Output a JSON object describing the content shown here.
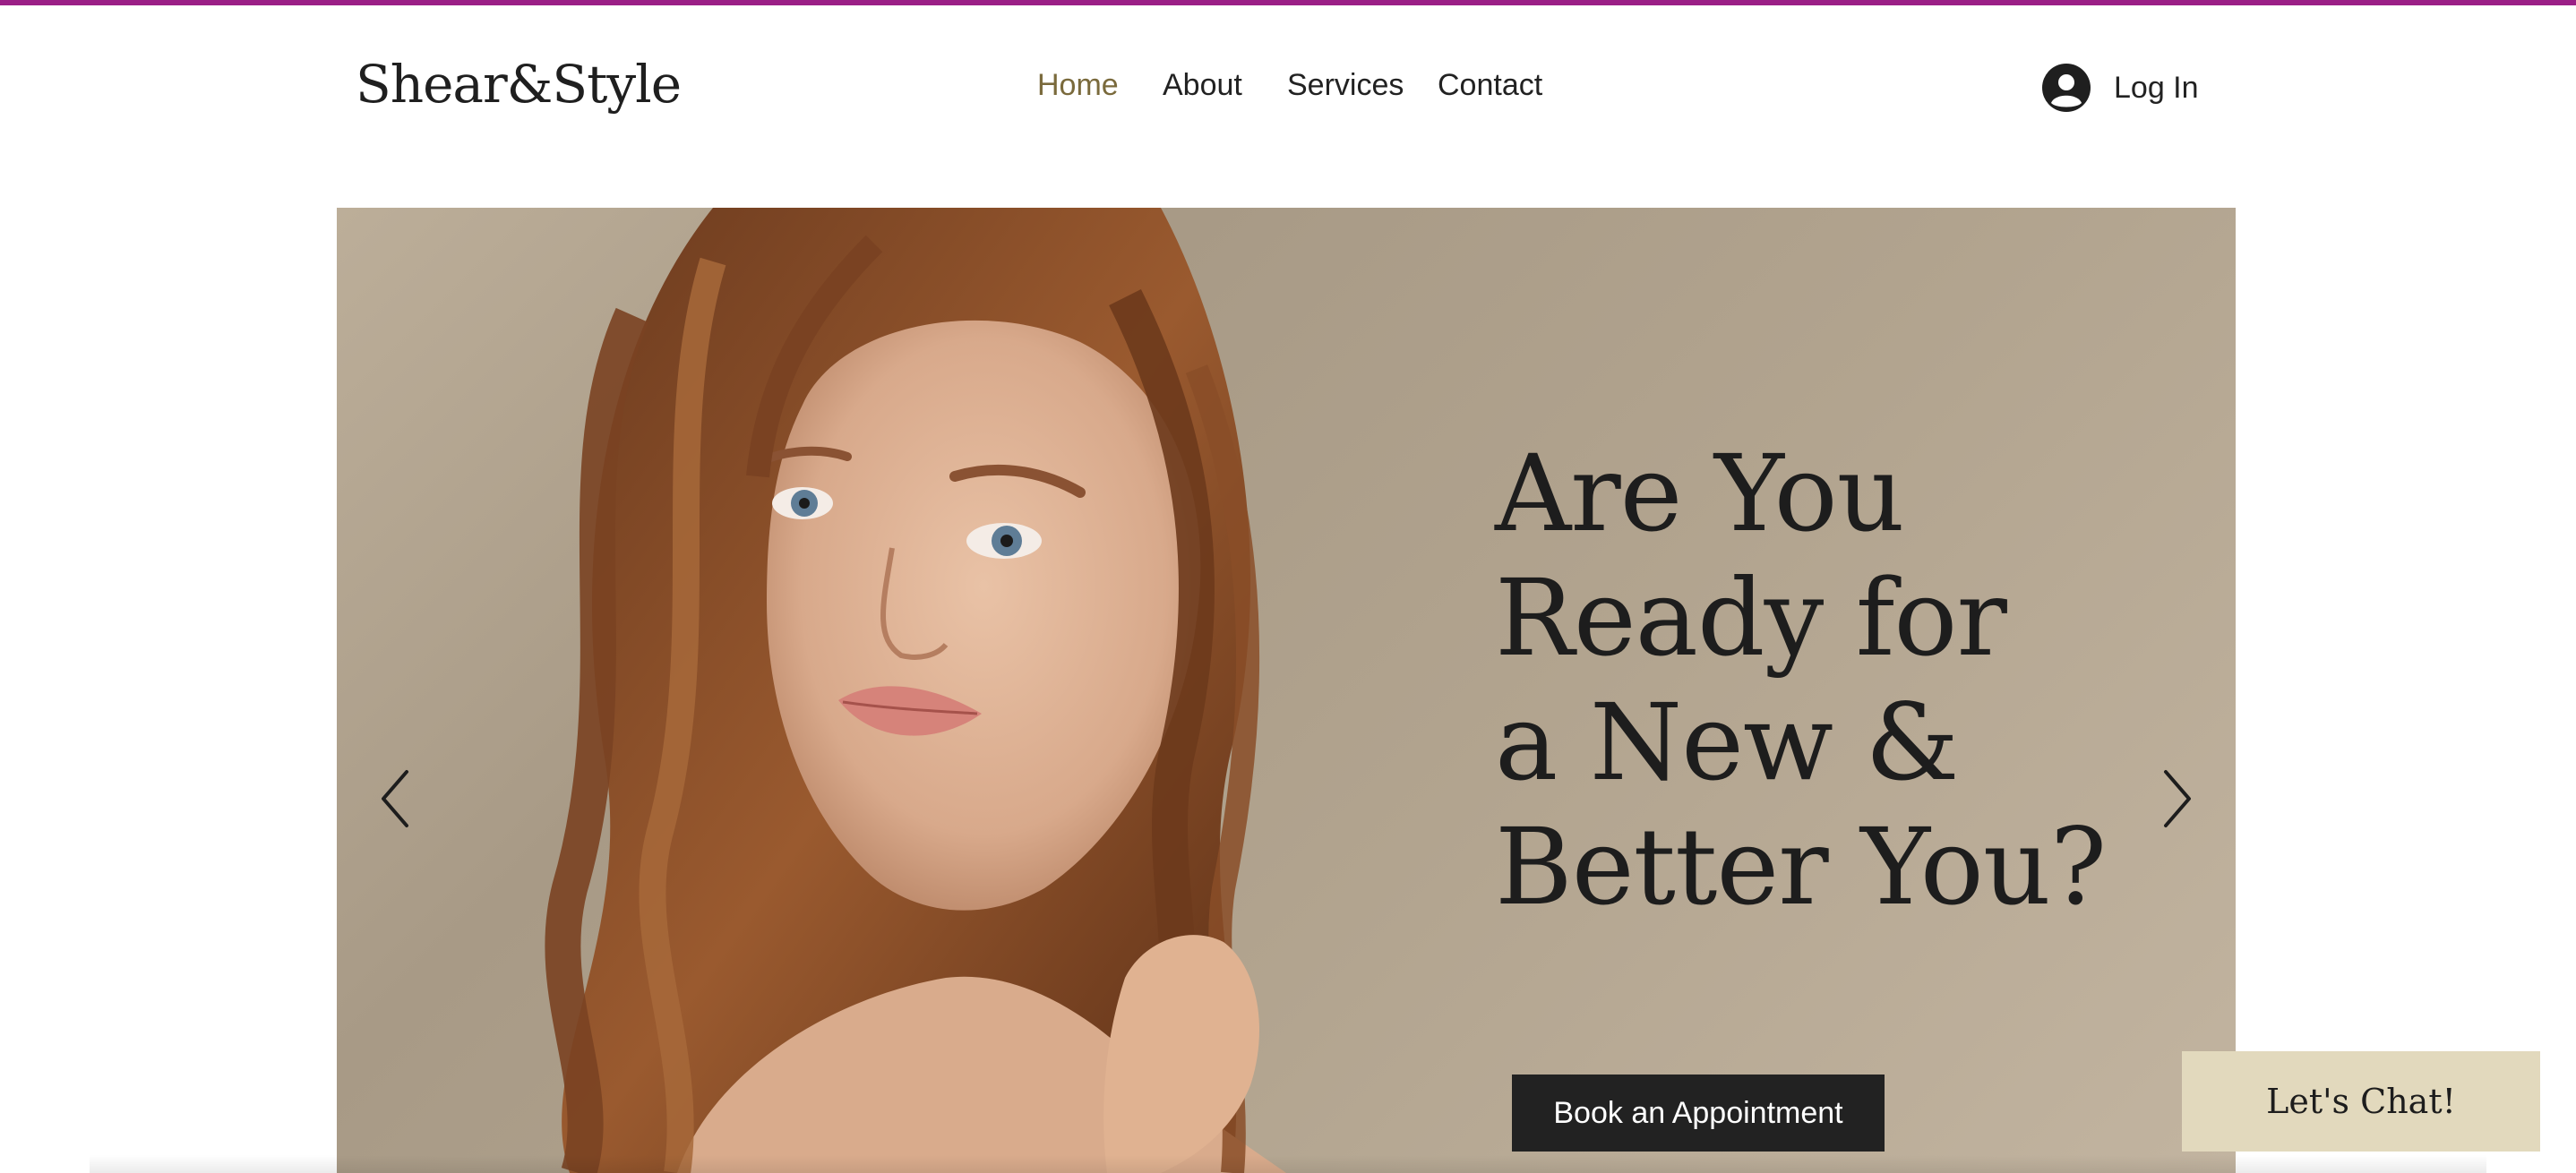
{
  "brand": {
    "name": "Shear&Style",
    "accent": "#9b1f86"
  },
  "nav": {
    "items": [
      {
        "label": "Home",
        "active": true,
        "color": "#7a6a3c"
      },
      {
        "label": "About"
      },
      {
        "label": "Services"
      },
      {
        "label": "Contact"
      }
    ]
  },
  "login": {
    "label": "Log In",
    "icon": "user-avatar-icon"
  },
  "hero": {
    "headline": [
      "Are You",
      "Ready for",
      "a New &",
      "Better You?"
    ],
    "cta_label": "Book an Appointment",
    "prev_icon": "chevron-left-icon",
    "next_icon": "chevron-right-icon",
    "image": "portrait of woman with wavy auburn hair"
  },
  "chat": {
    "label": "Let's Chat!",
    "background": "#e2d9bd"
  }
}
